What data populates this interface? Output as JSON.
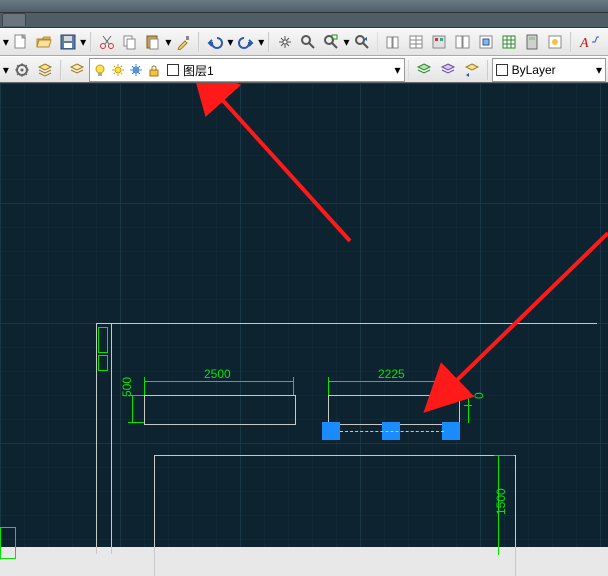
{
  "layer_combo": {
    "value": "图层1",
    "swatch": "#ffffff"
  },
  "linecolor_combo": {
    "value": "ByLayer",
    "swatch": "#ffffff"
  },
  "dimensions": {
    "dim_a": "2500",
    "dim_b": "2225",
    "dim_c": "500",
    "dim_d": "0",
    "dim_e": "1500"
  },
  "icons": {
    "new": "new",
    "open": "open",
    "save": "save",
    "cut": "cut",
    "copy": "copy",
    "paste": "paste",
    "match": "match",
    "undo": "undo",
    "redo": "redo",
    "pan": "pan",
    "zoom": "zoom",
    "zoomw": "zoomw",
    "zoomx": "zoomx",
    "sheet": "sheet",
    "props": "props",
    "tool": "tool",
    "block": "block",
    "table": "table",
    "calc": "calc",
    "markup": "markup",
    "textstyle": "textstyle",
    "gear": "gear",
    "layers1": "layers1",
    "layers2": "layers2",
    "sun": "sun",
    "freeze": "freeze",
    "lock": "lock",
    "filter": "filter",
    "state": "state",
    "prev": "prev"
  }
}
